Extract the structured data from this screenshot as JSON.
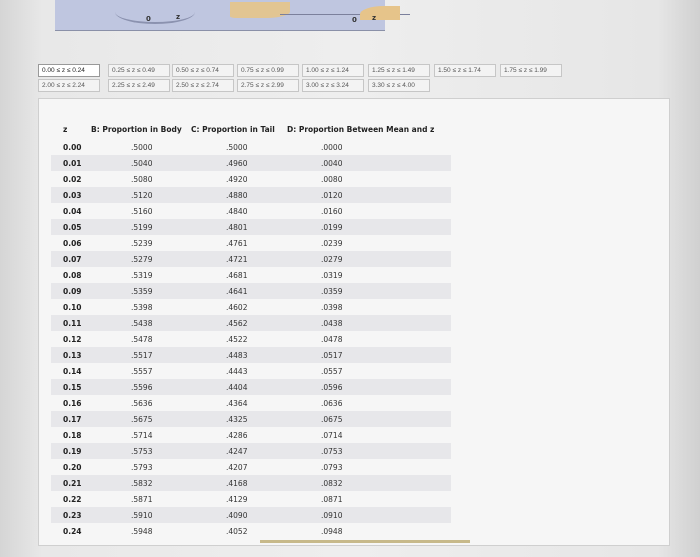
{
  "figure": {
    "left_axis": [
      "0",
      "z"
    ],
    "right_axis": [
      "0",
      "z"
    ]
  },
  "tabs": [
    {
      "label": "0.00 ≤ z ≤ 0.24",
      "active": true
    },
    {
      "label": "0.25 ≤ z ≤ 0.49"
    },
    {
      "label": "0.50 ≤ z ≤ 0.74"
    },
    {
      "label": "0.75 ≤ z ≤ 0.99"
    },
    {
      "label": "1.00 ≤ z ≤ 1.24"
    },
    {
      "label": "1.25 ≤ z ≤ 1.49"
    },
    {
      "label": "1.50 ≤ z ≤ 1.74"
    },
    {
      "label": "1.75 ≤ z ≤ 1.99"
    },
    {
      "label": "2.00 ≤ z ≤ 2.24"
    },
    {
      "label": "2.25 ≤ z ≤ 2.49"
    },
    {
      "label": "2.50 ≤ z ≤ 2.74"
    },
    {
      "label": "2.75 ≤ z ≤ 2.99"
    },
    {
      "label": "3.00 ≤ z ≤ 3.24"
    },
    {
      "label": "3.30 ≤ z ≤ 4.00"
    }
  ],
  "table": {
    "headers": {
      "z": "z",
      "b": "B: Proportion in Body",
      "c": "C: Proportion in Tail",
      "d": "D: Proportion Between Mean and z"
    },
    "rows": [
      {
        "z": "0.00",
        "b": ".5000",
        "c": ".5000",
        "d": ".0000"
      },
      {
        "z": "0.01",
        "b": ".5040",
        "c": ".4960",
        "d": ".0040"
      },
      {
        "z": "0.02",
        "b": ".5080",
        "c": ".4920",
        "d": ".0080"
      },
      {
        "z": "0.03",
        "b": ".5120",
        "c": ".4880",
        "d": ".0120"
      },
      {
        "z": "0.04",
        "b": ".5160",
        "c": ".4840",
        "d": ".0160"
      },
      {
        "z": "0.05",
        "b": ".5199",
        "c": ".4801",
        "d": ".0199"
      },
      {
        "z": "0.06",
        "b": ".5239",
        "c": ".4761",
        "d": ".0239"
      },
      {
        "z": "0.07",
        "b": ".5279",
        "c": ".4721",
        "d": ".0279"
      },
      {
        "z": "0.08",
        "b": ".5319",
        "c": ".4681",
        "d": ".0319"
      },
      {
        "z": "0.09",
        "b": ".5359",
        "c": ".4641",
        "d": ".0359"
      },
      {
        "z": "0.10",
        "b": ".5398",
        "c": ".4602",
        "d": ".0398"
      },
      {
        "z": "0.11",
        "b": ".5438",
        "c": ".4562",
        "d": ".0438"
      },
      {
        "z": "0.12",
        "b": ".5478",
        "c": ".4522",
        "d": ".0478"
      },
      {
        "z": "0.13",
        "b": ".5517",
        "c": ".4483",
        "d": ".0517"
      },
      {
        "z": "0.14",
        "b": ".5557",
        "c": ".4443",
        "d": ".0557"
      },
      {
        "z": "0.15",
        "b": ".5596",
        "c": ".4404",
        "d": ".0596"
      },
      {
        "z": "0.16",
        "b": ".5636",
        "c": ".4364",
        "d": ".0636"
      },
      {
        "z": "0.17",
        "b": ".5675",
        "c": ".4325",
        "d": ".0675"
      },
      {
        "z": "0.18",
        "b": ".5714",
        "c": ".4286",
        "d": ".0714"
      },
      {
        "z": "0.19",
        "b": ".5753",
        "c": ".4247",
        "d": ".0753"
      },
      {
        "z": "0.20",
        "b": ".5793",
        "c": ".4207",
        "d": ".0793"
      },
      {
        "z": "0.21",
        "b": ".5832",
        "c": ".4168",
        "d": ".0832"
      },
      {
        "z": "0.22",
        "b": ".5871",
        "c": ".4129",
        "d": ".0871"
      },
      {
        "z": "0.23",
        "b": ".5910",
        "c": ".4090",
        "d": ".0910"
      },
      {
        "z": "0.24",
        "b": ".5948",
        "c": ".4052",
        "d": ".0948"
      }
    ]
  }
}
